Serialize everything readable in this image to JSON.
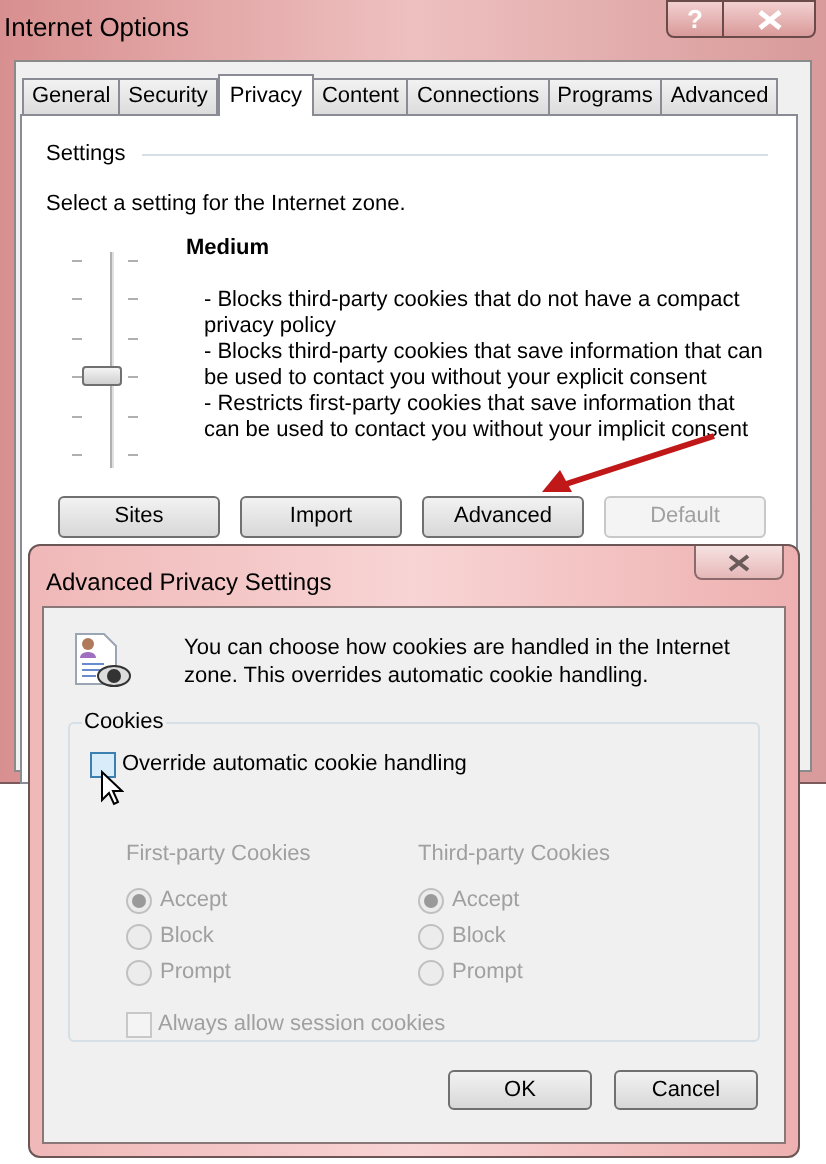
{
  "window": {
    "title": "Internet Options",
    "help_button": "?"
  },
  "tabs": [
    {
      "label": "General",
      "selected": false
    },
    {
      "label": "Security",
      "selected": false
    },
    {
      "label": "Privacy",
      "selected": true
    },
    {
      "label": "Content",
      "selected": false
    },
    {
      "label": "Connections",
      "selected": false
    },
    {
      "label": "Programs",
      "selected": false
    },
    {
      "label": "Advanced",
      "selected": false
    }
  ],
  "settings": {
    "group_label": "Settings",
    "prompt": "Select a setting for the Internet zone.",
    "slider": {
      "level": 0.4
    },
    "level_name": "Medium",
    "description": [
      "- Blocks third-party cookies that do not have a compact privacy policy",
      "- Blocks third-party cookies that save information that can be used to contact you without your explicit consent",
      "- Restricts first-party cookies that save information that can be used to contact you without your implicit consent"
    ]
  },
  "buttons": [
    {
      "label": "Sites",
      "disabled": false
    },
    {
      "label": "Import",
      "disabled": false
    },
    {
      "label": "Advanced",
      "disabled": false
    },
    {
      "label": "Default",
      "disabled": true
    }
  ],
  "dialog": {
    "title": "Advanced Privacy Settings",
    "message": "You can choose how cookies are handled in the Internet zone.  This overrides automatic cookie handling.",
    "cookies": {
      "group_label": "Cookies",
      "override": {
        "label": "Override automatic cookie handling",
        "checked": false,
        "disabled": false
      },
      "columns": [
        {
          "heading": "First-party Cookies",
          "disabled": true,
          "options": [
            {
              "label": "Accept",
              "selected": true
            },
            {
              "label": "Block",
              "selected": false
            },
            {
              "label": "Prompt",
              "selected": false
            }
          ]
        },
        {
          "heading": "Third-party Cookies",
          "disabled": true,
          "options": [
            {
              "label": "Accept",
              "selected": true
            },
            {
              "label": "Block",
              "selected": false
            },
            {
              "label": "Prompt",
              "selected": false
            }
          ]
        }
      ],
      "session": {
        "label": "Always allow session cookies",
        "checked": false,
        "disabled": true
      }
    },
    "buttons": [
      {
        "label": "OK"
      },
      {
        "label": "Cancel"
      }
    ]
  }
}
